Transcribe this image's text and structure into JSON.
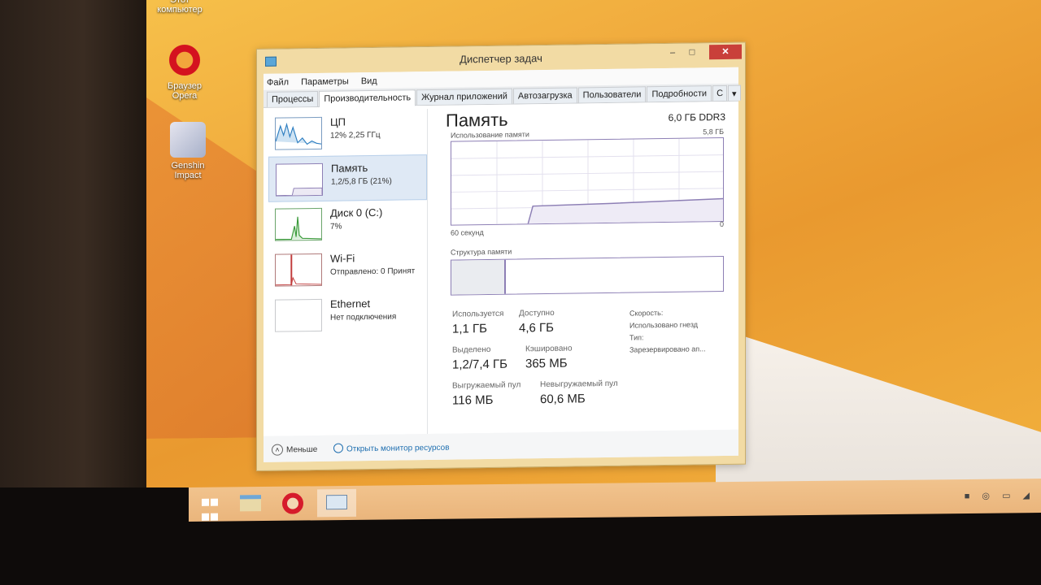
{
  "desktop": {
    "icons": [
      {
        "label": "Этот компьютер"
      },
      {
        "label": "Браузер Opera"
      },
      {
        "label": "Genshin Impact"
      }
    ]
  },
  "window": {
    "title": "Диспетчер задач",
    "controls": {
      "minimize": "–",
      "maximize": "□",
      "close": "✕"
    },
    "menu": [
      "Файл",
      "Параметры",
      "Вид"
    ],
    "tabs": [
      "Процессы",
      "Производительность",
      "Журнал приложений",
      "Автозагрузка",
      "Пользователи",
      "Подробности",
      "С",
      "▾"
    ],
    "active_tab": "Производительность"
  },
  "resources": [
    {
      "name": "ЦП",
      "sub": "12% 2,25 ГГц"
    },
    {
      "name": "Память",
      "sub": "1,2/5,8 ГБ (21%)"
    },
    {
      "name": "Диск 0 (C:)",
      "sub": "7%"
    },
    {
      "name": "Wi-Fi",
      "sub": "Отправлено: 0 Принят"
    },
    {
      "name": "Ethernet",
      "sub": "Нет подключения"
    }
  ],
  "memory": {
    "title": "Память",
    "type": "6,0 ГБ DDR3",
    "usage_label": "Использование памяти",
    "max_label": "5,8 ГБ",
    "time_label": "60 секунд",
    "zero_label": "0",
    "structure_label": "Структура памяти",
    "stats": {
      "in_use": {
        "k": "Используется",
        "v": "1,1 ГБ"
      },
      "available": {
        "k": "Доступно",
        "v": "4,6 ГБ"
      },
      "committed": {
        "k": "Выделено",
        "v": "1,2/7,4 ГБ"
      },
      "cached": {
        "k": "Кэшировано",
        "v": "365 МБ"
      },
      "paged_pool": {
        "k": "Выгружаемый пул",
        "v": "116 МБ"
      },
      "nonpaged_pool": {
        "k": "Невыгружаемый пул",
        "v": "60,6 МБ"
      }
    },
    "side": [
      "Скорость:",
      "Использовано гнезд",
      "Тип:",
      "Зарезервировано ап..."
    ]
  },
  "footer": {
    "less": "Меньше",
    "monitor": "Открыть монитор ресурсов"
  },
  "taskbar": {
    "tray": "■ ◎ ▭ ◢"
  },
  "colors": {
    "accent": "#8d7fb5",
    "window_frame": "#f2dba4",
    "close": "#c9403a",
    "desktop": "#f0a93c"
  }
}
